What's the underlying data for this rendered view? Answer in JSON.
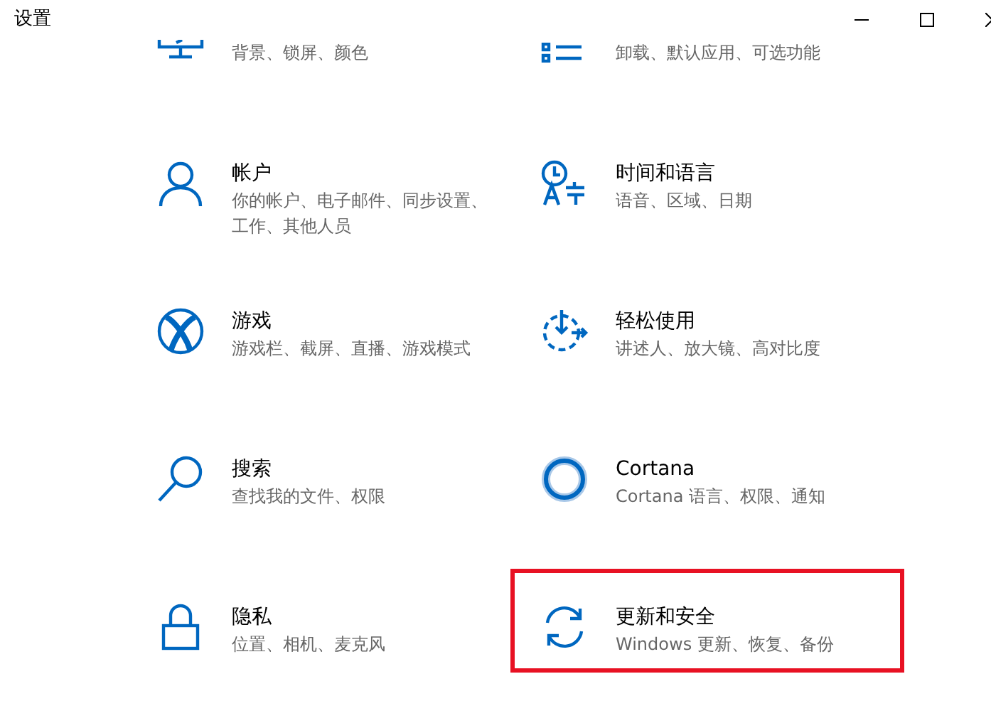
{
  "window": {
    "title": "设置"
  },
  "items": [
    {
      "kind": "monitor",
      "description": "背景、锁屏、颜色",
      "highlighted": false
    },
    {
      "kind": "apps",
      "description": "卸载、默认应用、可选功能",
      "highlighted": false
    },
    {
      "kind": "person",
      "title": "帐户",
      "description": "你的帐户、电子邮件、同步设置、工作、其他人员",
      "highlighted": false
    },
    {
      "kind": "language",
      "title": "时间和语言",
      "description": "语音、区域、日期",
      "highlighted": false
    },
    {
      "kind": "xbox",
      "title": "游戏",
      "description": "游戏栏、截屏、直播、游戏模式",
      "highlighted": false
    },
    {
      "kind": "ease",
      "title": "轻松使用",
      "description": "讲述人、放大镜、高对比度",
      "highlighted": false
    },
    {
      "kind": "search",
      "title": "搜索",
      "description": "查找我的文件、权限",
      "highlighted": false
    },
    {
      "kind": "cortana",
      "title": "Cortana",
      "description": "Cortana 语言、权限、通知",
      "highlighted": false
    },
    {
      "kind": "lock",
      "title": "隐私",
      "description": "位置、相机、麦克风",
      "highlighted": false
    },
    {
      "kind": "sync",
      "title": "更新和安全",
      "description": "Windows 更新、恢复、备份",
      "highlighted": true
    }
  ]
}
